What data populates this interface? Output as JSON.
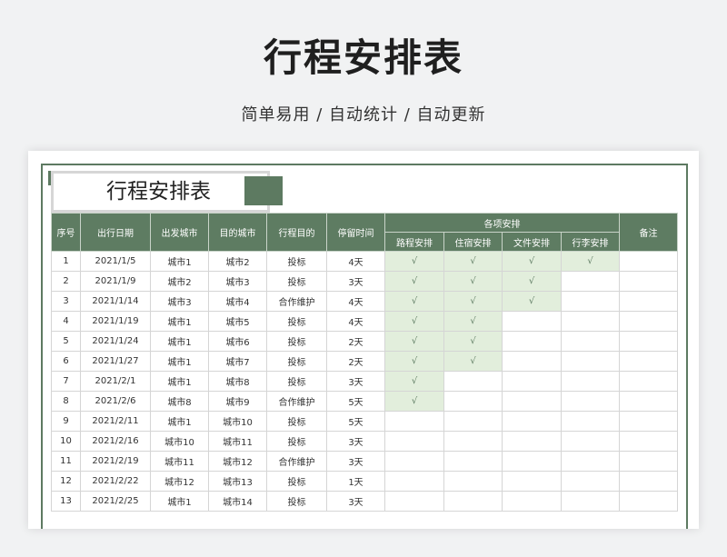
{
  "page": {
    "title": "行程安排表",
    "subtitle": "简单易用 / 自动统计 / 自动更新"
  },
  "sheet": {
    "title": "行程安排表",
    "headers": {
      "seq": "序号",
      "date": "出行日期",
      "from": "出发城市",
      "to": "目的城市",
      "purpose": "行程目的",
      "stay": "停留时间",
      "group": "各项安排",
      "sub": [
        "路程安排",
        "住宿安排",
        "文件安排",
        "行李安排"
      ],
      "remark": "备注"
    },
    "rows": [
      {
        "seq": "1",
        "date": "2021/1/5",
        "from": "城市1",
        "to": "城市2",
        "purpose": "投标",
        "stay": "4天",
        "checks": [
          "√",
          "√",
          "√",
          "√"
        ],
        "remark": ""
      },
      {
        "seq": "2",
        "date": "2021/1/9",
        "from": "城市2",
        "to": "城市3",
        "purpose": "投标",
        "stay": "3天",
        "checks": [
          "√",
          "√",
          "√",
          ""
        ],
        "remark": ""
      },
      {
        "seq": "3",
        "date": "2021/1/14",
        "from": "城市3",
        "to": "城市4",
        "purpose": "合作维护",
        "stay": "4天",
        "checks": [
          "√",
          "√",
          "√",
          ""
        ],
        "remark": ""
      },
      {
        "seq": "4",
        "date": "2021/1/19",
        "from": "城市1",
        "to": "城市5",
        "purpose": "投标",
        "stay": "4天",
        "checks": [
          "√",
          "√",
          "",
          ""
        ],
        "remark": ""
      },
      {
        "seq": "5",
        "date": "2021/1/24",
        "from": "城市1",
        "to": "城市6",
        "purpose": "投标",
        "stay": "2天",
        "checks": [
          "√",
          "√",
          "",
          ""
        ],
        "remark": ""
      },
      {
        "seq": "6",
        "date": "2021/1/27",
        "from": "城市1",
        "to": "城市7",
        "purpose": "投标",
        "stay": "2天",
        "checks": [
          "√",
          "√",
          "",
          ""
        ],
        "remark": ""
      },
      {
        "seq": "7",
        "date": "2021/2/1",
        "from": "城市1",
        "to": "城市8",
        "purpose": "投标",
        "stay": "3天",
        "checks": [
          "√",
          "",
          "",
          ""
        ],
        "remark": ""
      },
      {
        "seq": "8",
        "date": "2021/2/6",
        "from": "城市8",
        "to": "城市9",
        "purpose": "合作维护",
        "stay": "5天",
        "checks": [
          "√",
          "",
          "",
          ""
        ],
        "remark": ""
      },
      {
        "seq": "9",
        "date": "2021/2/11",
        "from": "城市1",
        "to": "城市10",
        "purpose": "投标",
        "stay": "5天",
        "checks": [
          "",
          "",
          "",
          ""
        ],
        "remark": ""
      },
      {
        "seq": "10",
        "date": "2021/2/16",
        "from": "城市10",
        "to": "城市11",
        "purpose": "投标",
        "stay": "3天",
        "checks": [
          "",
          "",
          "",
          ""
        ],
        "remark": ""
      },
      {
        "seq": "11",
        "date": "2021/2/19",
        "from": "城市11",
        "to": "城市12",
        "purpose": "合作维护",
        "stay": "3天",
        "checks": [
          "",
          "",
          "",
          ""
        ],
        "remark": ""
      },
      {
        "seq": "12",
        "date": "2021/2/22",
        "from": "城市12",
        "to": "城市13",
        "purpose": "投标",
        "stay": "1天",
        "checks": [
          "",
          "",
          "",
          ""
        ],
        "remark": ""
      },
      {
        "seq": "13",
        "date": "2021/2/25",
        "from": "城市1",
        "to": "城市14",
        "purpose": "投标",
        "stay": "3天",
        "checks": [
          "",
          "",
          "",
          ""
        ],
        "remark": ""
      }
    ]
  },
  "colors": {
    "accent": "#5e7c62",
    "check_fill": "#e2eedc"
  }
}
